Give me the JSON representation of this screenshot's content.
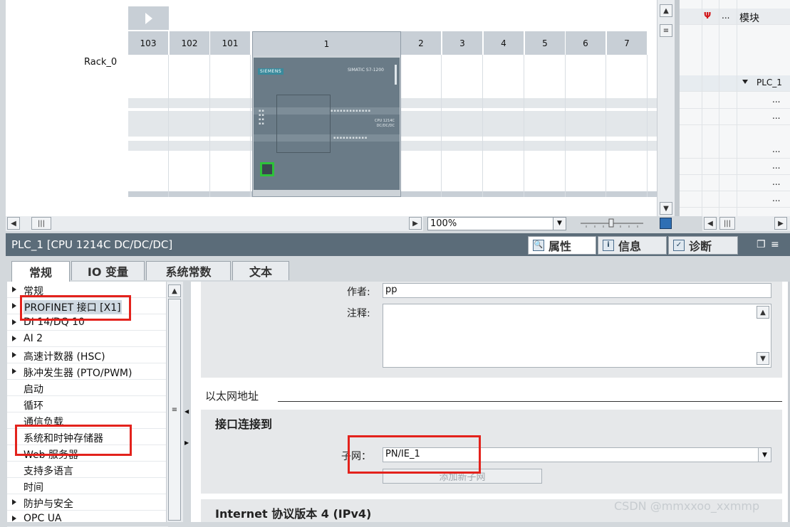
{
  "device_view": {
    "rack_label": "Rack_0",
    "slots": [
      {
        "label": "103"
      },
      {
        "label": "102"
      },
      {
        "label": "101"
      },
      {
        "label": "1"
      },
      {
        "label": "2"
      },
      {
        "label": "3"
      },
      {
        "label": "4"
      },
      {
        "label": "5"
      },
      {
        "label": "6"
      },
      {
        "label": "7"
      }
    ],
    "cpu": {
      "brand": "SIEMENS",
      "series": "SIMATIC S7-1200",
      "model": "CPU 1214C\nDC/DC/DC"
    },
    "zoom_value": "100%"
  },
  "tree_panel": {
    "header_ellipsis": "...",
    "header_label": "模块",
    "plc_label": "PLC_1",
    "ellipsis": "..."
  },
  "inspector": {
    "title": "PLC_1 [CPU 1214C DC/DC/DC]",
    "tabs": [
      {
        "label": "属性",
        "icon": "properties-icon"
      },
      {
        "label": "信息",
        "icon": "info-icon"
      },
      {
        "label": "诊断",
        "icon": "diagnostics-icon"
      }
    ],
    "subtabs": [
      {
        "label": "常规"
      },
      {
        "label": "IO 变量"
      },
      {
        "label": "系统常数"
      },
      {
        "label": "文本"
      }
    ],
    "nav_items": [
      {
        "label": "常规",
        "expandable": true
      },
      {
        "label": "PROFINET 接口 [X1]",
        "expandable": true
      },
      {
        "label": "DI 14/DQ 10",
        "expandable": true
      },
      {
        "label": "AI 2",
        "expandable": true
      },
      {
        "label": "高速计数器 (HSC)",
        "expandable": true
      },
      {
        "label": "脉冲发生器 (PTO/PWM)",
        "expandable": true
      },
      {
        "label": "启动",
        "expandable": false
      },
      {
        "label": "循环",
        "expandable": false
      },
      {
        "label": "通信负载",
        "expandable": false
      },
      {
        "label": "系统和时钟存储器",
        "expandable": false
      },
      {
        "label": "Web 服务器",
        "expandable": false
      },
      {
        "label": "支持多语言",
        "expandable": false
      },
      {
        "label": "时间",
        "expandable": false
      },
      {
        "label": "防护与安全",
        "expandable": true
      },
      {
        "label": "OPC UA",
        "expandable": true
      }
    ],
    "props": {
      "author_label": "作者:",
      "author_value": "pp",
      "comment_label": "注释:",
      "comment_value": "",
      "ethernet_section": "以太网地址",
      "interface_section": "接口连接到",
      "subnet_label": "子网：",
      "subnet_value": "PN/IE_1",
      "add_subnet_button": "添加新子网",
      "ipv4_section": "Internet 协议版本 4 (IPv4)"
    }
  },
  "watermark": "CSDN @mmxxoo_xxmmp",
  "colors": {
    "inspector_bar": "#5b6c79",
    "highlight_red": "#e3221c",
    "cpu_body": "#6a7b87",
    "port_green": "#2ec23a"
  }
}
